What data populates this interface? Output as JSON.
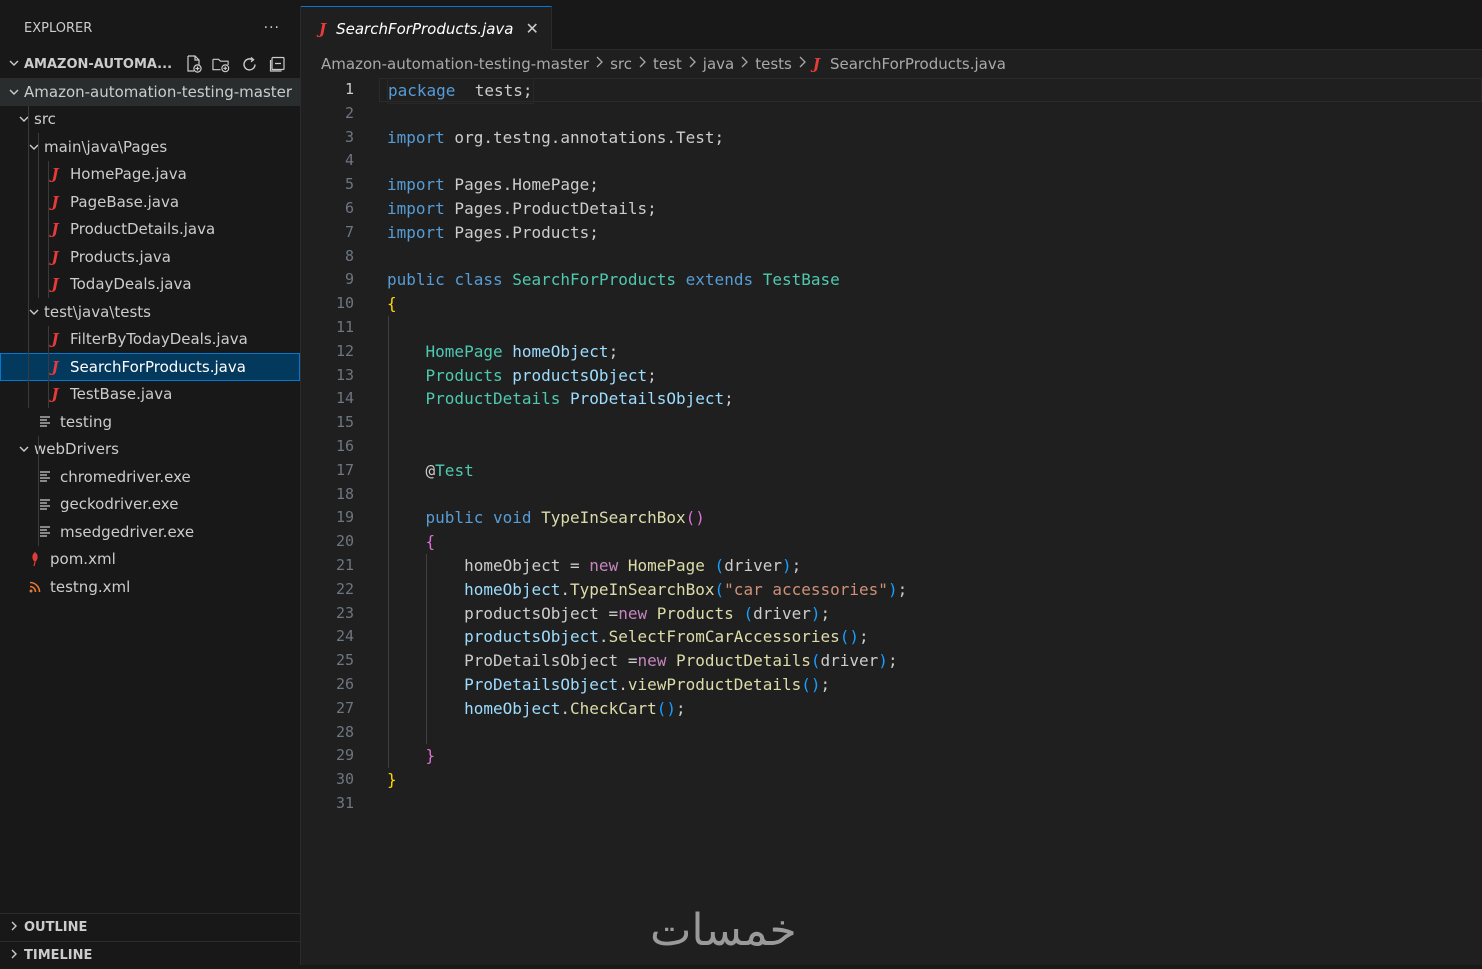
{
  "sidebar": {
    "title": "EXPLORER",
    "more": "···",
    "section": "AMAZON-AUTOMA...",
    "actions": [
      "new-file-icon",
      "new-folder-icon",
      "refresh-icon",
      "collapse-all-icon"
    ],
    "tree": [
      {
        "depth": 0,
        "type": "folder-open",
        "label": "Amazon-automation-testing-master"
      },
      {
        "depth": 1,
        "type": "folder-open",
        "label": "src"
      },
      {
        "depth": 2,
        "type": "folder-open",
        "label": "main\\java\\Pages"
      },
      {
        "depth": 3,
        "type": "java",
        "label": "HomePage.java"
      },
      {
        "depth": 3,
        "type": "java",
        "label": "PageBase.java"
      },
      {
        "depth": 3,
        "type": "java",
        "label": "ProductDetails.java"
      },
      {
        "depth": 3,
        "type": "java",
        "label": "Products.java"
      },
      {
        "depth": 3,
        "type": "java",
        "label": "TodayDeals.java"
      },
      {
        "depth": 2,
        "type": "folder-open",
        "label": "test\\java\\tests"
      },
      {
        "depth": 3,
        "type": "java",
        "label": "FilterByTodayDeals.java"
      },
      {
        "depth": 3,
        "type": "java",
        "label": "SearchForProducts.java",
        "selected": true
      },
      {
        "depth": 3,
        "type": "java",
        "label": "TestBase.java"
      },
      {
        "depth": 2,
        "type": "text",
        "label": "testing"
      },
      {
        "depth": 1,
        "type": "folder-open",
        "label": "webDrivers"
      },
      {
        "depth": 2,
        "type": "text",
        "label": "chromedriver.exe"
      },
      {
        "depth": 2,
        "type": "text",
        "label": "geckodriver.exe"
      },
      {
        "depth": 2,
        "type": "text",
        "label": "msedgedriver.exe"
      },
      {
        "depth": 1,
        "type": "maven",
        "label": "pom.xml"
      },
      {
        "depth": 1,
        "type": "rss",
        "label": "testng.xml"
      }
    ],
    "bottom_sections": [
      "OUTLINE",
      "TIMELINE"
    ]
  },
  "editor": {
    "tab": {
      "label": "SearchForProducts.java",
      "close": "✕"
    },
    "breadcrumbs": [
      "Amazon-automation-testing-master",
      "src",
      "test",
      "java",
      "tests",
      "SearchForProducts.java"
    ],
    "current_line": 1,
    "lines": [
      [
        [
          "kw",
          "package"
        ],
        [
          "",
          "  tests;"
        ]
      ],
      [],
      [
        [
          "kw",
          "import"
        ],
        [
          "",
          " org.testng.annotations.Test;"
        ]
      ],
      [],
      [
        [
          "kw",
          "import"
        ],
        [
          "",
          " Pages.HomePage;"
        ]
      ],
      [
        [
          "kw",
          "import"
        ],
        [
          "",
          " Pages.ProductDetails;"
        ]
      ],
      [
        [
          "kw",
          "import"
        ],
        [
          "",
          " Pages.Products;"
        ]
      ],
      [],
      [
        [
          "kw",
          "public"
        ],
        [
          "",
          " "
        ],
        [
          "kw",
          "class"
        ],
        [
          "",
          " "
        ],
        [
          "ty",
          "SearchForProducts"
        ],
        [
          "",
          " "
        ],
        [
          "kw",
          "extends"
        ],
        [
          "",
          " "
        ],
        [
          "ty",
          "TestBase"
        ]
      ],
      [
        [
          "b1",
          "{"
        ]
      ],
      [],
      [
        [
          "",
          "    "
        ],
        [
          "ty",
          "HomePage"
        ],
        [
          "",
          " "
        ],
        [
          "var",
          "homeObject"
        ],
        [
          "",
          ";"
        ]
      ],
      [
        [
          "",
          "    "
        ],
        [
          "ty",
          "Products"
        ],
        [
          "",
          " "
        ],
        [
          "var",
          "productsObject"
        ],
        [
          "",
          ";"
        ]
      ],
      [
        [
          "",
          "    "
        ],
        [
          "ty",
          "ProductDetails"
        ],
        [
          "",
          " "
        ],
        [
          "var",
          "ProDetailsObject"
        ],
        [
          "",
          ";"
        ]
      ],
      [],
      [],
      [
        [
          "",
          "    @"
        ],
        [
          "ty",
          "Test"
        ]
      ],
      [],
      [
        [
          "",
          "    "
        ],
        [
          "kw",
          "public"
        ],
        [
          "",
          " "
        ],
        [
          "kw",
          "void"
        ],
        [
          "",
          " "
        ],
        [
          "fn",
          "TypeInSearchBox"
        ],
        [
          "b2",
          "()"
        ]
      ],
      [
        [
          "",
          "    "
        ],
        [
          "b2",
          "{"
        ]
      ],
      [
        [
          "",
          "        "
        ],
        [
          "",
          "homeObject = "
        ],
        [
          "kw2",
          "new"
        ],
        [
          "",
          " "
        ],
        [
          "fn",
          "HomePage"
        ],
        [
          "",
          " "
        ],
        [
          "b3",
          "("
        ],
        [
          "",
          "driver"
        ],
        [
          "b3",
          ")"
        ],
        [
          "",
          ";"
        ]
      ],
      [
        [
          "",
          "        "
        ],
        [
          "var",
          "homeObject"
        ],
        [
          "",
          "."
        ],
        [
          "fn",
          "TypeInSearchBox"
        ],
        [
          "b3",
          "("
        ],
        [
          "str",
          "\"car accessories\""
        ],
        [
          "b3",
          ")"
        ],
        [
          "",
          ";"
        ]
      ],
      [
        [
          "",
          "        "
        ],
        [
          "",
          "productsObject ="
        ],
        [
          "kw2",
          "new"
        ],
        [
          "",
          " "
        ],
        [
          "fn",
          "Products"
        ],
        [
          "",
          " "
        ],
        [
          "b3",
          "("
        ],
        [
          "",
          "driver"
        ],
        [
          "b3",
          ")"
        ],
        [
          "",
          ";"
        ]
      ],
      [
        [
          "",
          "        "
        ],
        [
          "var",
          "productsObject"
        ],
        [
          "",
          "."
        ],
        [
          "fn",
          "SelectFromCarAccessories"
        ],
        [
          "b3",
          "()"
        ],
        [
          "",
          ";"
        ]
      ],
      [
        [
          "",
          "        "
        ],
        [
          "",
          "ProDetailsObject ="
        ],
        [
          "kw2",
          "new"
        ],
        [
          "",
          " "
        ],
        [
          "fn",
          "ProductDetails"
        ],
        [
          "b3",
          "("
        ],
        [
          "",
          "driver"
        ],
        [
          "b3",
          ")"
        ],
        [
          "",
          ";"
        ]
      ],
      [
        [
          "",
          "        "
        ],
        [
          "var",
          "ProDetailsObject"
        ],
        [
          "",
          "."
        ],
        [
          "fn",
          "viewProductDetails"
        ],
        [
          "b3",
          "()"
        ],
        [
          "",
          ";"
        ]
      ],
      [
        [
          "",
          "        "
        ],
        [
          "var",
          "homeObject"
        ],
        [
          "",
          "."
        ],
        [
          "fn",
          "CheckCart"
        ],
        [
          "b3",
          "()"
        ],
        [
          "",
          ";"
        ]
      ],
      [],
      [
        [
          "",
          "    "
        ],
        [
          "b2",
          "}"
        ]
      ],
      [
        [
          "b1",
          "}"
        ]
      ],
      []
    ]
  },
  "watermark": "خمسات"
}
